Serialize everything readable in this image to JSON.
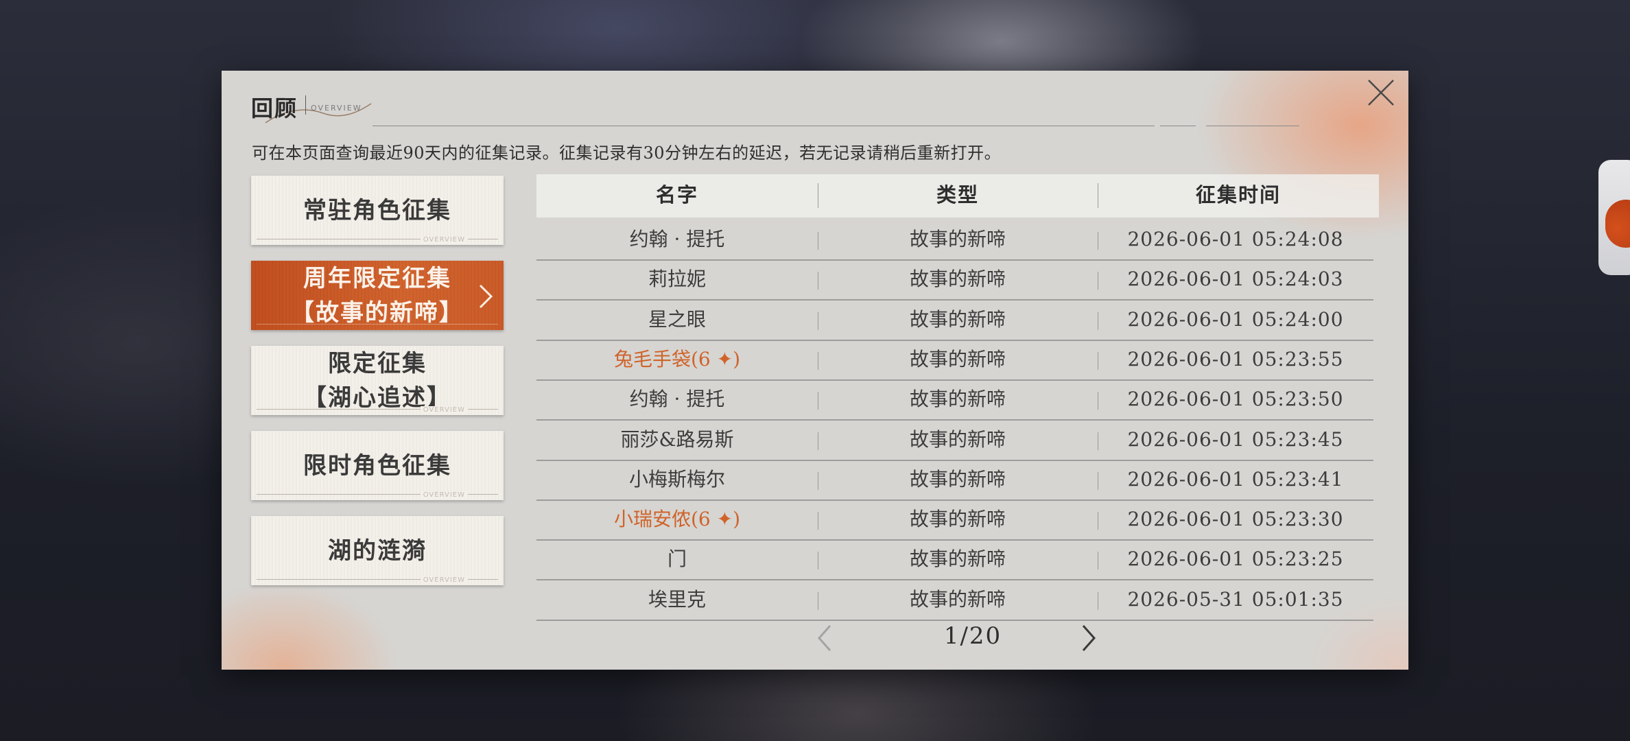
{
  "panel": {
    "title": "回顾",
    "title_sub": "OVERVIEW",
    "notice": "可在本页面查询最近90天内的征集记录。征集记录有30分钟左右的延迟，若无记录请稍后重新打开。"
  },
  "tabs": [
    {
      "label": "常驻角色征集",
      "active": false,
      "deco": "OVERVIEW"
    },
    {
      "label": "周年限定征集\n【故事的新啼】",
      "active": true,
      "deco": ""
    },
    {
      "label": "限定征集\n【湖心追述】",
      "active": false,
      "deco": "OVERVIEW"
    },
    {
      "label": "限时角色征集",
      "active": false,
      "deco": "OVERVIEW"
    },
    {
      "label": "湖的涟漪",
      "active": false,
      "deco": "OVERVIEW"
    }
  ],
  "table": {
    "headers": {
      "name": "名字",
      "type": "类型",
      "time": "征集时间"
    },
    "rows": [
      {
        "name": "约翰 · 提托",
        "type": "故事的新啼",
        "time": "2026-06-01 05:24:08",
        "highlight": false
      },
      {
        "name": "莉拉妮",
        "type": "故事的新啼",
        "time": "2026-06-01 05:24:03",
        "highlight": false
      },
      {
        "name": "星之眼",
        "type": "故事的新啼",
        "time": "2026-06-01 05:24:00",
        "highlight": false
      },
      {
        "name": "兔毛手袋(6 ✦)",
        "type": "故事的新啼",
        "time": "2026-06-01 05:23:55",
        "highlight": true
      },
      {
        "name": "约翰 · 提托",
        "type": "故事的新啼",
        "time": "2026-06-01 05:23:50",
        "highlight": false
      },
      {
        "name": "丽莎&路易斯",
        "type": "故事的新啼",
        "time": "2026-06-01 05:23:45",
        "highlight": false
      },
      {
        "name": "小梅斯梅尔",
        "type": "故事的新啼",
        "time": "2026-06-01 05:23:41",
        "highlight": false
      },
      {
        "name": "小瑞安侬(6 ✦)",
        "type": "故事的新啼",
        "time": "2026-06-01 05:23:30",
        "highlight": true
      },
      {
        "name": "门",
        "type": "故事的新啼",
        "time": "2026-06-01 05:23:25",
        "highlight": false
      },
      {
        "name": "埃里克",
        "type": "故事的新啼",
        "time": "2026-05-31 05:01:35",
        "highlight": false
      }
    ]
  },
  "pager": {
    "text": "1/20"
  },
  "colors": {
    "accent": "#d0632a",
    "active_tab": "#c9582a",
    "panel_bg": "#d6d5d2"
  }
}
